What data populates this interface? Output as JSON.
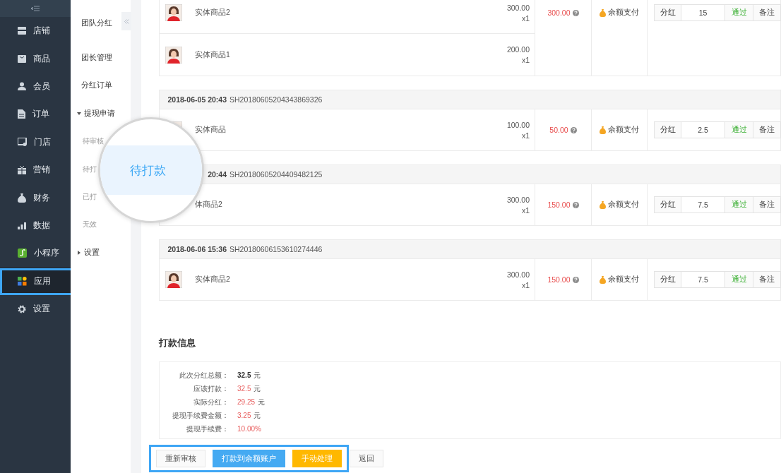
{
  "main_nav": {
    "items": [
      {
        "label": "店铺",
        "selected": false,
        "highlighted": false
      },
      {
        "label": "商品",
        "selected": false,
        "highlighted": false
      },
      {
        "label": "会员",
        "selected": false,
        "highlighted": false
      },
      {
        "label": "订单",
        "selected": false,
        "highlighted": false
      },
      {
        "label": "门店",
        "selected": false,
        "highlighted": false
      },
      {
        "label": "营销",
        "selected": false,
        "highlighted": false
      },
      {
        "label": "财务",
        "selected": false,
        "highlighted": false
      },
      {
        "label": "数据",
        "selected": false,
        "highlighted": false
      },
      {
        "label": "小程序",
        "selected": false,
        "highlighted": false
      },
      {
        "label": "应用",
        "selected": true,
        "highlighted": true
      },
      {
        "label": "设置",
        "selected": false,
        "highlighted": false
      }
    ]
  },
  "sub_nav": {
    "items": [
      {
        "label": "团队分红"
      },
      {
        "label": "团长管理"
      },
      {
        "label": "分红订单"
      },
      {
        "label": "提现申请",
        "expanded": true,
        "children": [
          {
            "label": "待审核"
          },
          {
            "label": "待打"
          },
          {
            "label": "已打"
          },
          {
            "label": "无效"
          }
        ]
      },
      {
        "label": "设置",
        "expanded": false
      }
    ]
  },
  "magnifier": {
    "label": "待打款"
  },
  "orders": [
    {
      "items": [
        {
          "name": "实体商品2",
          "price": "300.00",
          "qty": "x1"
        },
        {
          "name": "实体商品1",
          "price": "200.00",
          "qty": "x1"
        }
      ],
      "amount": "300.00",
      "payment": "余额支付",
      "action_label": "分红",
      "action_value": "15",
      "status": "通过",
      "remark": "备注"
    },
    {
      "date": "2018-06-05 20:43",
      "order_no": "SH20180605204343869326",
      "items": [
        {
          "name": "实体商品",
          "price": "100.00",
          "qty": "x1"
        }
      ],
      "amount": "50.00",
      "payment": "余额支付",
      "action_label": "分红",
      "action_value": "2.5",
      "status": "通过",
      "remark": "备注"
    },
    {
      "date": "20:44",
      "order_no": "SH20180605204409482125",
      "items": [
        {
          "name": "体商品2",
          "price": "300.00",
          "qty": "x1"
        }
      ],
      "amount": "150.00",
      "payment": "余额支付",
      "action_label": "分红",
      "action_value": "7.5",
      "status": "通过",
      "remark": "备注"
    },
    {
      "date": "2018-06-06 15:36",
      "order_no": "SH20180606153610274446",
      "items": [
        {
          "name": "实体商品2",
          "price": "300.00",
          "qty": "x1"
        }
      ],
      "amount": "150.00",
      "payment": "余额支付",
      "action_label": "分红",
      "action_value": "7.5",
      "status": "通过",
      "remark": "备注"
    }
  ],
  "payment_info": {
    "title": "打款信息",
    "rows": [
      {
        "label": "此次分红总额：",
        "value": "32.5",
        "unit": "元",
        "bold": true,
        "alert": false
      },
      {
        "label": "应该打款：",
        "value": "32.5",
        "unit": "元",
        "bold": false,
        "alert": true
      },
      {
        "label": "实际分红：",
        "value": "29.25",
        "unit": "元",
        "bold": false,
        "alert": true
      },
      {
        "label": "提现手续费金额：",
        "value": "3.25",
        "unit": "元",
        "bold": false,
        "alert": true
      },
      {
        "label": "提现手续费：",
        "value": "10.00%",
        "bold": false,
        "alert": true
      }
    ]
  },
  "actions": {
    "highlighted": true,
    "buttons": [
      {
        "label": "重新审核",
        "kind": "default"
      },
      {
        "label": "打款到余额账户",
        "kind": "primary"
      },
      {
        "label": "手动处理",
        "kind": "warning"
      }
    ],
    "back_button": {
      "label": "返回"
    }
  }
}
